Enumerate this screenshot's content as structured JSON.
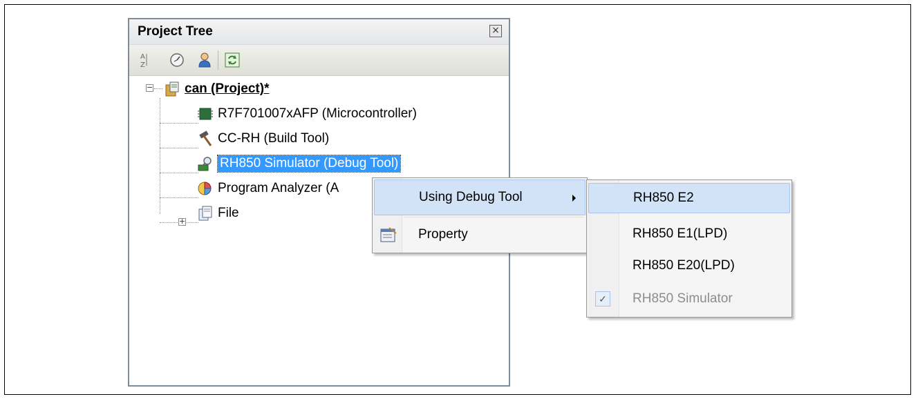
{
  "panel": {
    "title": "Project Tree",
    "toolbar": {
      "icons": [
        "sort-az-icon",
        "clock-icon",
        "user-icon",
        "refresh-icon"
      ]
    }
  },
  "tree": {
    "project": {
      "label": "can (Project)*",
      "expander": "−"
    },
    "children": [
      {
        "label": "R7F701007xAFP (Microcontroller)"
      },
      {
        "label": "CC-RH (Build Tool)"
      },
      {
        "label": "RH850 Simulator (Debug Tool)"
      },
      {
        "label": "Program Analyzer (A"
      },
      {
        "label": "File",
        "expander": "+"
      }
    ]
  },
  "context_menu": {
    "items": [
      {
        "label": "Using Debug Tool",
        "highlighted": true,
        "has_submenu": true
      },
      {
        "label": "Property",
        "highlighted": false
      }
    ]
  },
  "submenu": {
    "items": [
      {
        "label": "RH850 E2",
        "highlighted": true,
        "disabled": false,
        "checked": false
      },
      {
        "label": "RH850 E1(LPD)",
        "highlighted": false,
        "disabled": false,
        "checked": false
      },
      {
        "label": "RH850 E20(LPD)",
        "highlighted": false,
        "disabled": false,
        "checked": false
      },
      {
        "label": "RH850 Simulator",
        "highlighted": false,
        "disabled": true,
        "checked": true
      }
    ]
  },
  "colors": {
    "selection": "#3399ff",
    "menu_highlight": "#d2e2f7"
  }
}
